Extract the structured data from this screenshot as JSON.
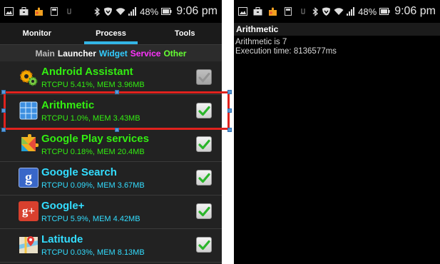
{
  "status_bar": {
    "battery_percent": "48%",
    "time": "9:06 pm",
    "icons": [
      "image-icon",
      "briefcase-icon",
      "puzzle-icon",
      "card-icon",
      "clip-icon",
      "bluetooth-icon",
      "shield-icon",
      "wifi-icon",
      "signal-icon",
      "battery-icon"
    ]
  },
  "left_screen": {
    "tabs": [
      {
        "label": "Monitor",
        "active": false
      },
      {
        "label": "Process",
        "active": true
      },
      {
        "label": "Tools",
        "active": false
      }
    ],
    "filters": [
      {
        "label": "Main",
        "color": "#bdbdbd"
      },
      {
        "label": "Launcher",
        "color": "#ffffff"
      },
      {
        "label": "Widget",
        "color": "#33ccff"
      },
      {
        "label": "Service",
        "color": "#ff33ff"
      },
      {
        "label": "Other",
        "color": "#66ff33"
      }
    ],
    "processes": [
      {
        "name": "Android Assistant",
        "stats": "RTCPU 5.41%, MEM 3.96MB",
        "color": "#33ee11",
        "icon": "gear-icon",
        "checked": false
      },
      {
        "name": "Arithmetic",
        "stats": "RTCPU 1.0%, MEM 3.43MB",
        "color": "#33ee11",
        "icon": "calculator-icon",
        "checked": true
      },
      {
        "name": "Google Play services",
        "stats": "RTCPU 0.18%, MEM 20.4MB",
        "color": "#33ee11",
        "icon": "puzzle-icon",
        "checked": true
      },
      {
        "name": "Google Search",
        "stats": "RTCPU 0.09%, MEM 3.67MB",
        "color": "#33ddff",
        "icon": "google-search-icon",
        "icon_text": "g",
        "checked": true
      },
      {
        "name": "Google+",
        "stats": "RTCPU 5.9%, MEM 4.42MB",
        "color": "#33ddff",
        "icon": "google-plus-icon",
        "icon_text": "g+",
        "checked": true
      },
      {
        "name": "Latitude",
        "stats": "RTCPU 0.03%, MEM 8.13MB",
        "color": "#33ddff",
        "icon": "map-pin-icon",
        "checked": true
      }
    ]
  },
  "right_screen": {
    "title": "Arithmetic",
    "result_line": "Arithmetic is 7",
    "execution_line": "Execution time: 8136577ms"
  }
}
